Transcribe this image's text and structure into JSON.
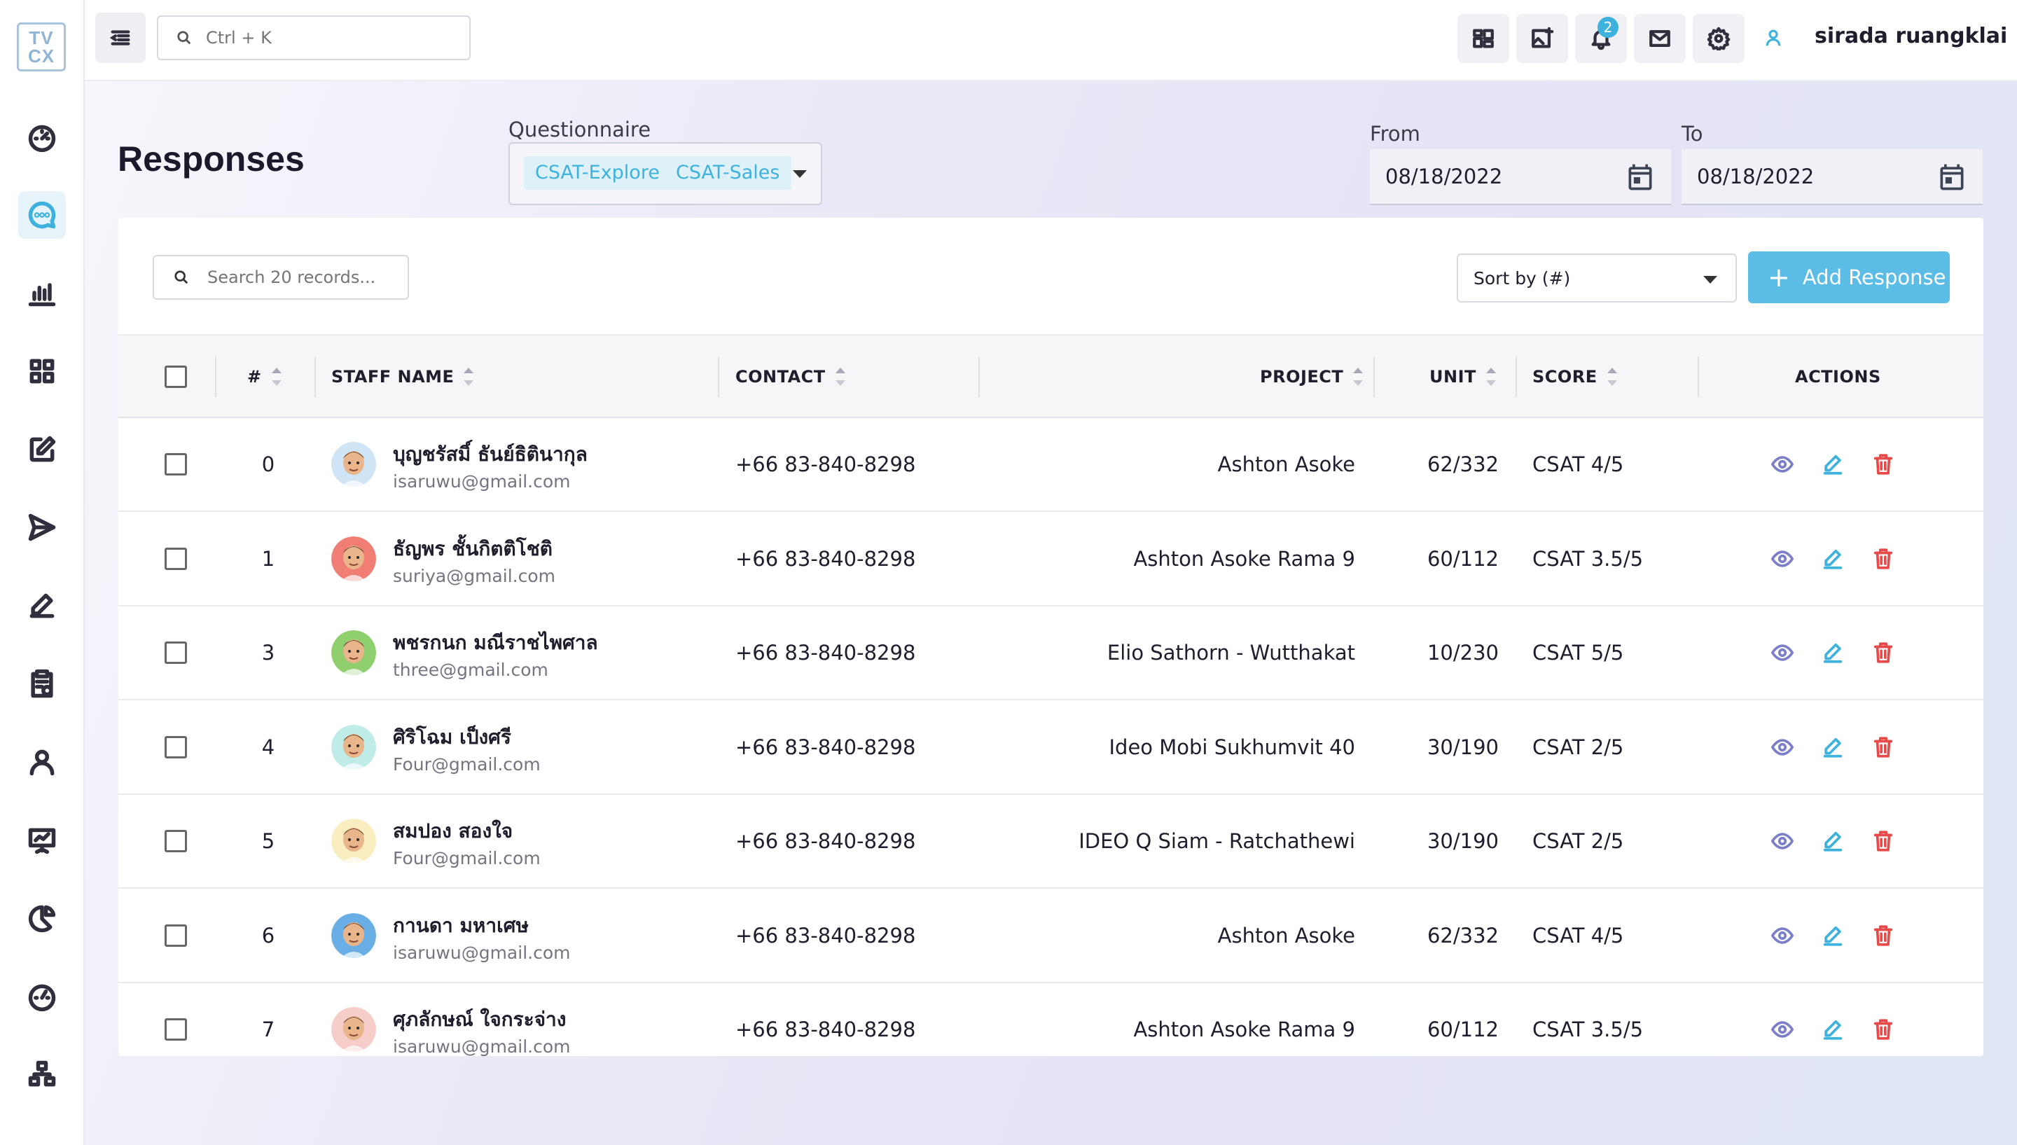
{
  "app": {
    "logo_line1": "TV",
    "logo_line2": "CX"
  },
  "topbar": {
    "search_placeholder": "Ctrl + K",
    "notification_count": "2",
    "user_name": "sirada ruangklai"
  },
  "sidebar": {
    "items": [
      {
        "icon": "speedometer-icon",
        "active": false
      },
      {
        "icon": "chat-bubble-icon",
        "active": true
      },
      {
        "icon": "bar-chart-icon",
        "active": false
      },
      {
        "icon": "grid-icon",
        "active": false
      },
      {
        "icon": "edit-square-icon",
        "active": false
      },
      {
        "icon": "send-icon",
        "active": false
      },
      {
        "icon": "pen-icon",
        "active": false
      },
      {
        "icon": "clipboard-check-icon",
        "active": false
      },
      {
        "icon": "user-icon",
        "active": false
      },
      {
        "icon": "presentation-icon",
        "active": false
      },
      {
        "icon": "pie-chart-icon",
        "active": false
      },
      {
        "icon": "gauge-icon",
        "active": false
      },
      {
        "icon": "org-chart-icon",
        "active": false
      }
    ]
  },
  "page": {
    "title": "Responses",
    "questionnaire_label": "Questionnaire",
    "questionnaire_chips": [
      "CSAT-Explore",
      "CSAT-Sales"
    ],
    "from_label": "From",
    "from_value": "08/18/2022",
    "to_label": "To",
    "to_value": "08/18/2022"
  },
  "toolbar": {
    "search_placeholder": "Search 20 records...",
    "sort_value": "Sort by (#)",
    "add_label": "Add Response"
  },
  "table": {
    "headers": {
      "num": "#",
      "staff": "STAFF NAME",
      "contact": "CONTACT",
      "project": "PROJECT",
      "unit": "UNIT",
      "score": "SCORE",
      "actions": "ACTIONS"
    },
    "rows": [
      {
        "num": "0",
        "name": "บุญชรัสมิ์ ธันย์ธิตินากุล",
        "email": "isaruwu@gmail.com",
        "contact": "+66 83-840-8298",
        "project": "Ashton Asoke",
        "unit": "62/332",
        "score": "CSAT 4/5",
        "avatar_color": "#cfe4f5"
      },
      {
        "num": "1",
        "name": "ธัญพร ชั้นกิตติโชติ",
        "email": "suriya@gmail.com",
        "contact": "+66 83-840-8298",
        "project": "Ashton Asoke Rama 9",
        "unit": "60/112",
        "score": "CSAT 3.5/5",
        "avatar_color": "#f07e74"
      },
      {
        "num": "3",
        "name": "พชรกนก มณีราชไพศาล",
        "email": "three@gmail.com",
        "contact": "+66 83-840-8298",
        "project": "Elio Sathorn - Wutthakat",
        "unit": "10/230",
        "score": "CSAT 5/5",
        "avatar_color": "#8fcf6e"
      },
      {
        "num": "4",
        "name": "ศิริโฉม เป็งศรี",
        "email": "Four@gmail.com",
        "contact": "+66 83-840-8298",
        "project": "Ideo Mobi Sukhumvit 40",
        "unit": "30/190",
        "score": "CSAT 2/5",
        "avatar_color": "#bfece6"
      },
      {
        "num": "5",
        "name": "สมปอง สองใจ",
        "email": "Four@gmail.com",
        "contact": "+66 83-840-8298",
        "project": "IDEO Q Siam - Ratchathewi",
        "unit": "30/190",
        "score": "CSAT 2/5",
        "avatar_color": "#faeec0"
      },
      {
        "num": "6",
        "name": "กานดา มหาเศษ",
        "email": "isaruwu@gmail.com",
        "contact": "+66 83-840-8298",
        "project": "Ashton Asoke",
        "unit": "62/332",
        "score": "CSAT 4/5",
        "avatar_color": "#6aaee6"
      },
      {
        "num": "7",
        "name": "ศุภลักษณ์ ใจกระจ่าง",
        "email": "isaruwu@gmail.com",
        "contact": "+66 83-840-8298",
        "project": "Ashton Asoke Rama 9",
        "unit": "60/112",
        "score": "CSAT 3.5/5",
        "avatar_color": "#f6cdc9"
      }
    ]
  },
  "colors": {
    "accent": "#3eb2dd",
    "button": "#5bbde6",
    "view_icon": "#7b7fc9",
    "delete_icon": "#e84a4a"
  }
}
